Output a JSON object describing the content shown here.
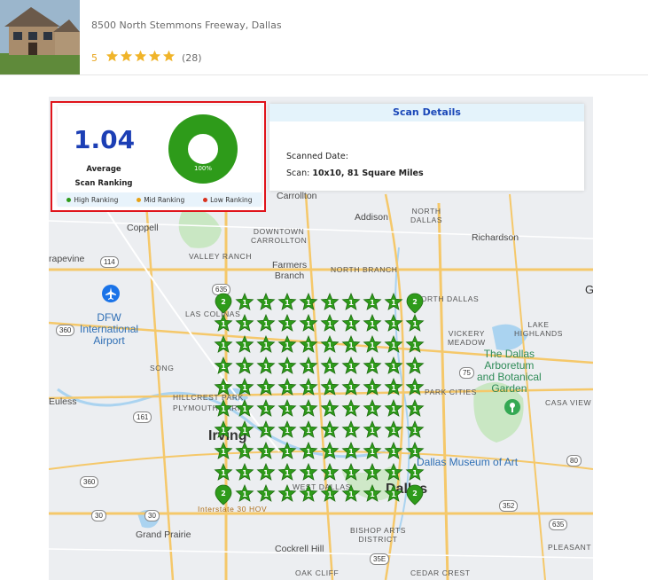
{
  "listing": {
    "address": "8500 North Stemmons Freeway, Dallas",
    "rating": "5",
    "review_count": "(28)",
    "star_count": 5,
    "star_color": "#f0b429"
  },
  "summary": {
    "average_value": "1.04",
    "average_label_line1": "Average",
    "average_label_line2": "Scan Ranking",
    "donut_percent": "100%",
    "donut_fraction": 1.0,
    "donut_color": "#2e9b1a",
    "legend": [
      {
        "label": "High Ranking",
        "color": "#2e9b1a"
      },
      {
        "label": "Mid Ranking",
        "color": "#e8a317"
      },
      {
        "label": "Low Ranking",
        "color": "#d9331f"
      }
    ]
  },
  "scan_details": {
    "title": "Scan Details",
    "scanned_date_label": "Scanned Date:",
    "scan_label": "Scan:",
    "scan_value": "10x10, 81 Square Miles"
  },
  "grid": {
    "rows": 10,
    "cols": 10,
    "pin_color": "#2e9b1a",
    "ranks": [
      [
        2,
        1,
        1,
        1,
        1,
        1,
        1,
        1,
        1,
        2
      ],
      [
        1,
        1,
        1,
        1,
        1,
        1,
        1,
        1,
        1,
        1
      ],
      [
        1,
        1,
        1,
        1,
        1,
        1,
        1,
        1,
        1,
        1
      ],
      [
        1,
        1,
        1,
        1,
        1,
        1,
        1,
        1,
        1,
        1
      ],
      [
        1,
        1,
        1,
        1,
        1,
        1,
        1,
        1,
        1,
        1
      ],
      [
        1,
        1,
        1,
        1,
        1,
        1,
        1,
        1,
        1,
        1
      ],
      [
        1,
        1,
        1,
        1,
        1,
        1,
        1,
        1,
        1,
        1
      ],
      [
        1,
        1,
        1,
        1,
        1,
        1,
        1,
        1,
        1,
        1
      ],
      [
        1,
        1,
        1,
        1,
        1,
        1,
        1,
        1,
        1,
        1
      ],
      [
        2,
        1,
        1,
        1,
        1,
        1,
        1,
        1,
        1,
        2
      ]
    ]
  },
  "map_labels": {
    "irving": "Irving",
    "dallas": "Dallas",
    "carrollton": "Carrollton",
    "addison": "Addison",
    "north_dallas": "NORTH\nDALLAS",
    "richardson": "Richardson",
    "coppell": "Coppell",
    "downtown_carrollton": "DOWNTOWN\nCARROLLTON",
    "valley_ranch": "VALLEY RANCH",
    "farmers_branch": "Farmers\nBranch",
    "north_branch": "NORTH BRANCH",
    "grapevine": "rapevine",
    "dfw": "DFW\nInternational\nAirport",
    "las_colinas": "LAS COLINAS",
    "song": "SONG",
    "hillcrest": "HILLCREST PARK",
    "plymouth": "PLYMOUTH PARK",
    "euless": "Euless",
    "north_dallas2": "NORTH DALLAS",
    "vickery": "VICKERY\nMEADOW",
    "lake_highlands": "LAKE\nHIGHLANDS",
    "arboretum": "The Dallas\nArboretum\nand Botanical\nGarden",
    "casa_view": "CASA VIEW",
    "museum": "Dallas Museum of Art",
    "park_cities": "PARK CITIES",
    "grand_prairie": "Grand Prairie",
    "cockrell": "Cockrell Hill",
    "bishop": "BISHOP ARTS\nDISTRICT",
    "oak_cliff": "OAK CLIFF",
    "pleasant": "PLEASANT",
    "cedar_crest": "CEDAR CREST",
    "interstate": "Interstate 30 HOV",
    "west_dallas": "WEST DALLAS",
    "g_edge": "G"
  }
}
